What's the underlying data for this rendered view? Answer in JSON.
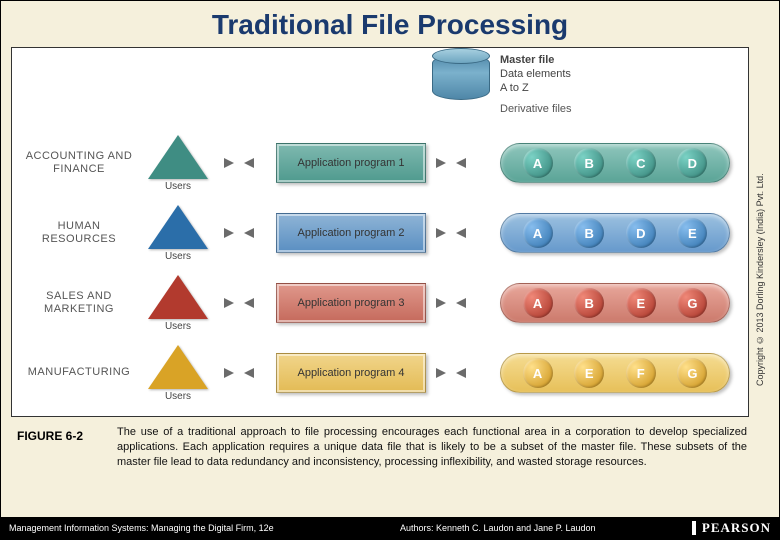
{
  "title": "Traditional File Processing",
  "master": {
    "label1": "Master file",
    "label2": "Data elements",
    "label3": "A to Z",
    "derivative": "Derivative files"
  },
  "rows": [
    {
      "theme": "teal",
      "dept": "ACCOUNTING AND FINANCE",
      "users": "Users",
      "app": "Application program 1",
      "elems": [
        "A",
        "B",
        "C",
        "D"
      ]
    },
    {
      "theme": "blue",
      "dept": "HUMAN RESOURCES",
      "users": "Users",
      "app": "Application program 2",
      "elems": [
        "A",
        "B",
        "D",
        "E"
      ]
    },
    {
      "theme": "red",
      "dept": "SALES AND MARKETING",
      "users": "Users",
      "app": "Application program 3",
      "elems": [
        "A",
        "B",
        "E",
        "G"
      ]
    },
    {
      "theme": "gold",
      "dept": "MANUFACTURING",
      "users": "Users",
      "app": "Application program 4",
      "elems": [
        "A",
        "E",
        "F",
        "G"
      ]
    }
  ],
  "figure_label": "FIGURE 6-2",
  "caption": "The use of a traditional approach to file processing encourages each functional area in a corporation to develop specialized applications. Each application requires a unique data file that is likely to be a subset of the master file. These subsets of the master file lead to data redundancy and inconsistency, processing inflexibility, and wasted storage resources.",
  "footer": {
    "book": "Management Information Systems: Managing the Digital Firm, 12e",
    "authors": "Authors: Kenneth C. Laudon and Jane P. Laudon",
    "brand": "PEARSON"
  },
  "copyright": "Copyright © 2013 Dorling Kindersley (India) Pvt. Ltd."
}
